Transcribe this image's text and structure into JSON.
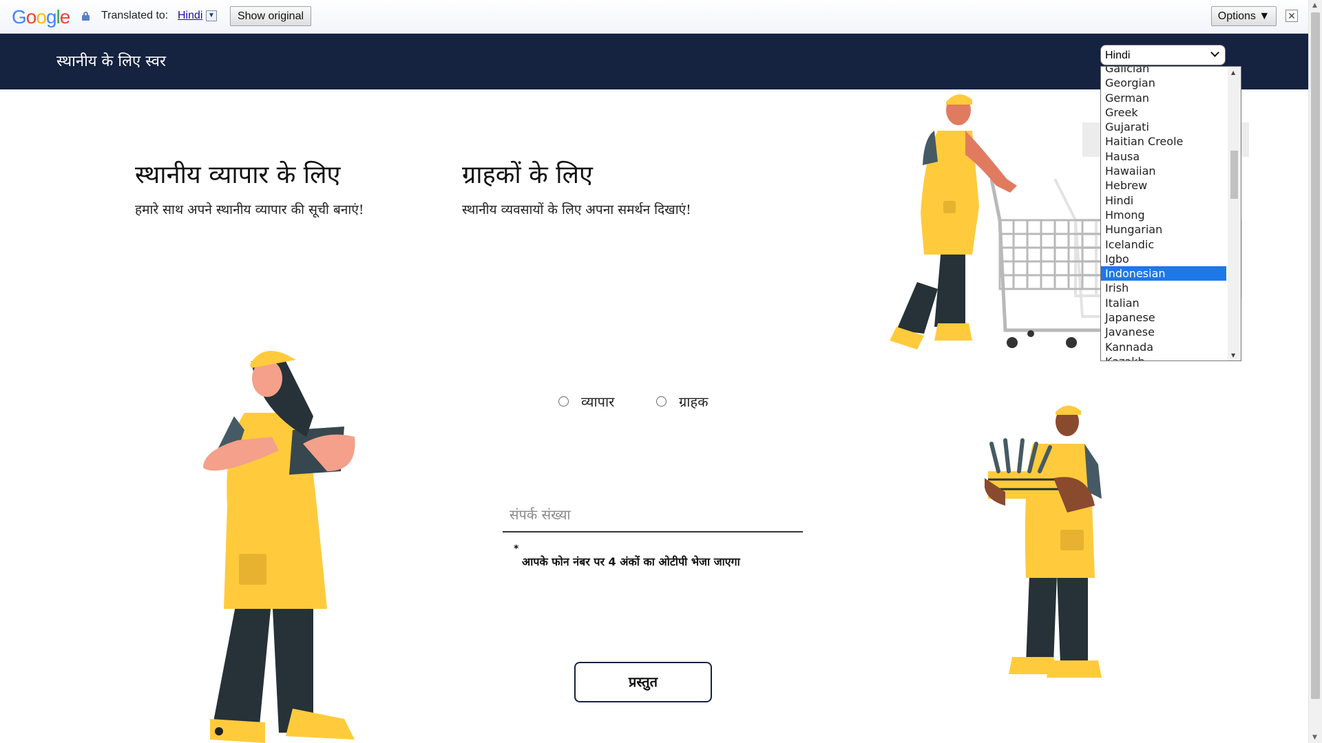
{
  "translate_bar": {
    "translated_to_label": "Translated to:",
    "language": "Hindi",
    "show_original": "Show original",
    "options": "Options ▼",
    "close": "✕"
  },
  "site": {
    "brand": "स्थानीय के लिए स्वर"
  },
  "language_select": {
    "value": "Hindi",
    "options": [
      "Galician",
      "Georgian",
      "German",
      "Greek",
      "Gujarati",
      "Haitian Creole",
      "Hausa",
      "Hawaiian",
      "Hebrew",
      "Hindi",
      "Hmong",
      "Hungarian",
      "Icelandic",
      "Igbo",
      "Indonesian",
      "Irish",
      "Italian",
      "Japanese",
      "Javanese",
      "Kannada",
      "Kazakh"
    ],
    "highlighted": "Indonesian"
  },
  "business": {
    "title": "स्थानीय व्यापार के लिए",
    "subtitle": "हमारे साथ अपने स्थानीय व्यापार की सूची बनाएं!"
  },
  "customer": {
    "title": "ग्राहकों के लिए",
    "subtitle": "स्थानीय व्यवसायों के लिए अपना समर्थन दिखाएं!"
  },
  "form": {
    "radio_business": "व्यापार",
    "radio_customer": "ग्राहक",
    "phone_placeholder": "संपर्क संख्या",
    "asterisk": "*",
    "otp_note": "आपके फोन नंबर पर 4 अंकों का ओटीपी भेजा जाएगा",
    "submit": "प्रस्तुत"
  },
  "colors": {
    "navbar": "#152240",
    "accent_yellow": "#ffcb3c",
    "dark_pants": "#263238",
    "selection_blue": "#1e78e8"
  }
}
